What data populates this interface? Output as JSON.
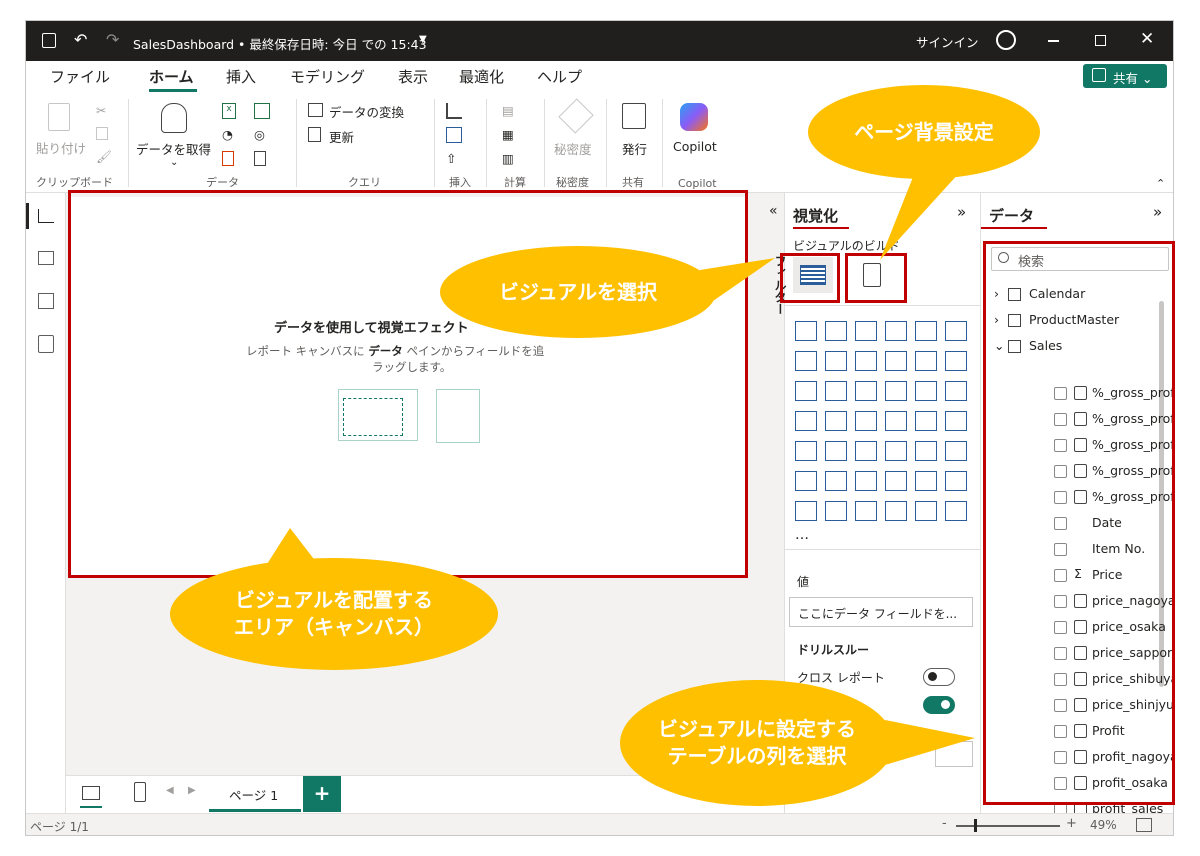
{
  "titlebar": {
    "title": "SalesDashboard • 最終保存日時: 今日 での 15:43",
    "signin": "サインイン"
  },
  "menu": {
    "tabs": [
      "ファイル",
      "ホーム",
      "挿入",
      "モデリング",
      "表示",
      "最適化",
      "ヘルプ"
    ],
    "share": "共有"
  },
  "ribbon": {
    "paste": "貼り付け",
    "get_data": "データを取得",
    "transform": "データの変換",
    "refresh": "更新",
    "sensitivity": "秘密度",
    "publish": "発行",
    "copilot": "Copilot",
    "groups": [
      "クリップボード",
      "データ",
      "クエリ",
      "挿入",
      "計算",
      "秘密度",
      "共有",
      "Copilot"
    ]
  },
  "canvas": {
    "title": "データを使用して視覚エフェクト",
    "desc_line1_a": "レポート キャンバスに ",
    "desc_line1_b": "データ",
    "desc_line1_c": " ペインからフィールドを追",
    "desc_line2": "ラッグします。"
  },
  "viz": {
    "title": "視覚化",
    "build": "ビジュアルのビルド",
    "filters": "フィルター",
    "more": "…",
    "values_label": "値",
    "values_placeholder": "ここにデータ フィールドを...",
    "drill": "ドリルスルー",
    "cross_report": "クロス レポート"
  },
  "data": {
    "title": "データ",
    "search_placeholder": "検索",
    "tables": [
      "Calendar",
      "ProductMaster",
      "Sales"
    ],
    "fields": [
      "%_gross_profi...",
      "%_gross_profi...",
      "%_gross_profi...",
      "%_gross_profi...",
      "%_gross_profi...",
      "Date",
      "Item No.",
      "Price",
      "price_nagoya",
      "price_osaka",
      "price_sapporo",
      "price_shibuya",
      "price_shinjyuku",
      "Profit",
      "profit_nagoya",
      "profit_osaka",
      "profit_sales"
    ]
  },
  "pages": {
    "tab": "ページ 1",
    "add": "+"
  },
  "status": {
    "page": "ページ 1/1",
    "zoom": "49%"
  },
  "callouts": {
    "bg": "ページ背景設定",
    "select_visual": "ビジュアルを選択",
    "canvas_line1": "ビジュアルを配置する",
    "canvas_line2": "エリア（キャンバス）",
    "field_line1": "ビジュアルに設定する",
    "field_line2": "テーブルの列を選択"
  },
  "colors": {
    "accent": "#117865",
    "callout": "#ffc000",
    "highlight": "#c00000"
  }
}
